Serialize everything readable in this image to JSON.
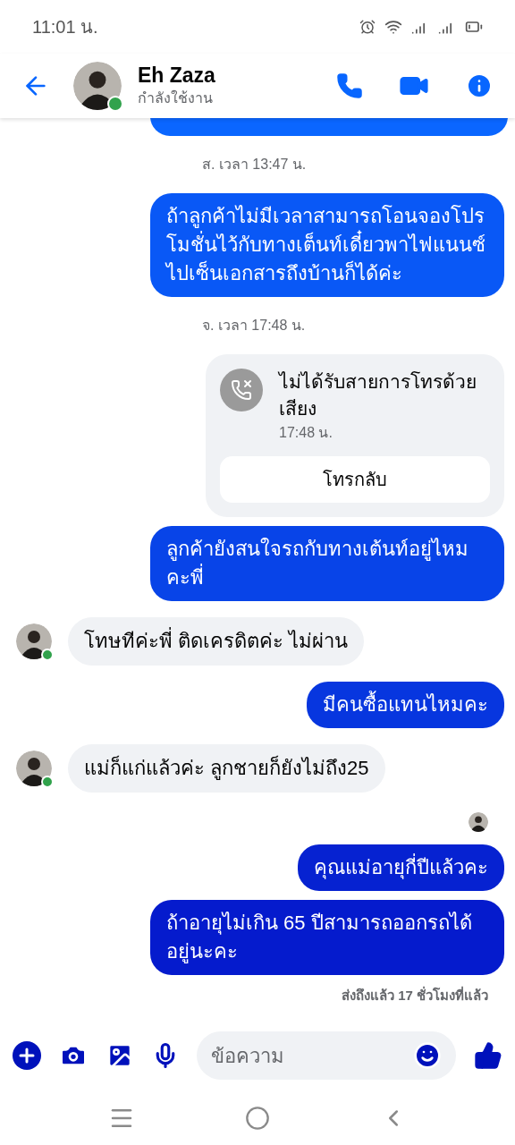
{
  "status_bar": {
    "time": "11:01 น."
  },
  "header": {
    "name": "Eh Zaza",
    "status": "กำลังใช้งาน",
    "online": true
  },
  "messages": [
    {
      "kind": "partial"
    },
    {
      "kind": "timestamp",
      "text": "ส. เวลา 13:47 น."
    },
    {
      "kind": "outgoing",
      "text": "ถ้าลูกค้าไม่มีเวลาสามารถโอนจองโปรโมชั่นไว้กับทางเต็นท์เดี๋ยวพาไฟแนนซ์ไปเซ็นเอกสารถึงบ้านก็ได้ค่ะ"
    },
    {
      "kind": "timestamp",
      "text": "จ. เวลา 17:48 น."
    },
    {
      "kind": "missed_call",
      "text": "ไม่ได้รับสายการโทรด้วยเสียง",
      "time": "17:48 น.",
      "action": "โทรกลับ"
    },
    {
      "kind": "outgoing",
      "text": "ลูกค้ายังสนใจรถกับทางเต้นท์อยู่ไหมคะพี่"
    },
    {
      "kind": "incoming",
      "text": "โทษทีค่ะพี่ ติดเครดิตค่ะ ไม่ผ่าน",
      "online": true
    },
    {
      "kind": "outgoing",
      "text": "มีคนซื้อแทนไหมคะ"
    },
    {
      "kind": "incoming",
      "text": "แม่ก็แก่แล้วค่ะ ลูกชายก็ยังไม่ถึง25",
      "online": true
    },
    {
      "kind": "seen"
    },
    {
      "kind": "outgoing",
      "text": "คุณแม่อายุกี่ปีแล้วคะ"
    },
    {
      "kind": "outgoing",
      "text": "ถ้าอายุไม่เกิน 65 ปีสามารถออกรถได้อยู่นะคะ"
    },
    {
      "kind": "receipt",
      "text": "ส่งถึงแล้ว 17 ชั่วโมงที่แล้ว"
    }
  ],
  "composer": {
    "placeholder": "ข้อความ"
  }
}
